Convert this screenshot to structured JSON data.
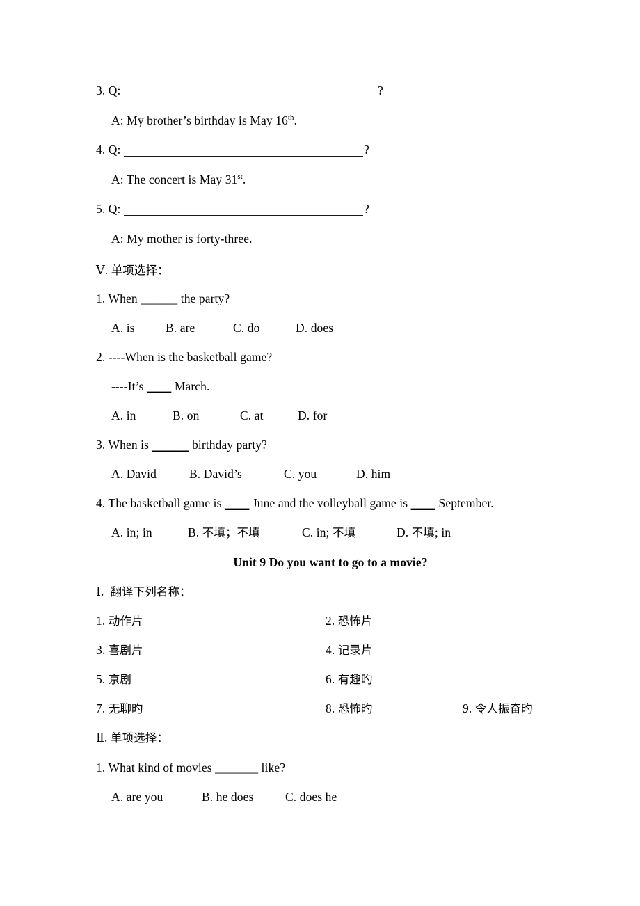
{
  "document": {
    "type": "english-exam-worksheet",
    "background_color": "#ffffff",
    "text_color": "#000000"
  },
  "section_unit8_tail": {
    "items": [
      {
        "number": "3. Q:",
        "question_blank": "________________________________________",
        "question_mark": "?",
        "answer": "A: My brother’s birthday is May 16",
        "answer_sup": "th",
        "answer_tail": "."
      },
      {
        "number": "4. Q:",
        "question_blank": "_____________________________________",
        "question_mark": "?",
        "answer": "A: The concert is May 31",
        "answer_sup": "st",
        "answer_tail": "."
      },
      {
        "number": "5. Q:",
        "question_blank": "_____________________________________",
        "question_mark": "?",
        "answer": "A: My mother is forty-three.",
        "answer_sup": "",
        "answer_tail": ""
      }
    ]
  },
  "section_v": {
    "label": "Ⅴ.",
    "title": "单项选择：",
    "questions": [
      {
        "stem_pre": "1. When ",
        "stem_blank": "______",
        "stem_post": " the party?",
        "options": [
          "A. is",
          "B. are",
          "C. do",
          "D. does"
        ]
      },
      {
        "stem_pre": "2. ----When is the basketball game?",
        "stem_blank": "",
        "stem_post": "",
        "sub_pre": "----It’s ",
        "sub_blank": "____",
        "sub_post": " March.",
        "options": [
          "A. in",
          "B. on",
          "C. at",
          "D. for"
        ]
      },
      {
        "stem_pre": "3. When is ",
        "stem_blank": "______",
        "stem_post": " birthday party?",
        "options": [
          "A. David",
          "B. David’s",
          "C. you",
          "D. him"
        ]
      },
      {
        "stem_pre": "4. The basketball game is ",
        "stem_blank": "____",
        "stem_mid": " June and the volleyball game is ",
        "stem_blank2": "____",
        "stem_post": " September.",
        "options_mixed": [
          {
            "letter": "A. ",
            "text": "in; in",
            "han": ""
          },
          {
            "letter": "B. ",
            "han1": "不填",
            "sep": "；",
            "han2": "不填"
          },
          {
            "letter": "C. ",
            "text": "in; ",
            "han": "不填"
          },
          {
            "letter": "D. ",
            "han": "不填",
            "tail": "; in"
          }
        ]
      }
    ]
  },
  "unit9": {
    "heading": "Unit 9 Do you want to go to a movie?"
  },
  "section_i": {
    "label": "Ⅰ.",
    "title": "翻译下列名称：",
    "vocab": [
      {
        "num": "1.",
        "text": "动作片"
      },
      {
        "num": "2.",
        "text": "恐怖片"
      },
      {
        "num": "3.",
        "text": "喜剧片"
      },
      {
        "num": "4.",
        "text": "记录片"
      },
      {
        "num": "5.",
        "text": "京剧"
      },
      {
        "num": "6.",
        "text": "有趣旳"
      },
      {
        "num": "7.",
        "text": "无聊旳"
      },
      {
        "num": "8.",
        "text": "恐怖旳"
      },
      {
        "num": "9.",
        "text": "令人振奋旳"
      }
    ]
  },
  "section_ii": {
    "label": "Ⅱ.",
    "title": "单项选择：",
    "questions": [
      {
        "stem_pre": "1. What kind of movies ",
        "stem_blank": "_______",
        "stem_post": " like?",
        "options": [
          "A. are you",
          "B. he does",
          "C. does he"
        ]
      }
    ]
  }
}
